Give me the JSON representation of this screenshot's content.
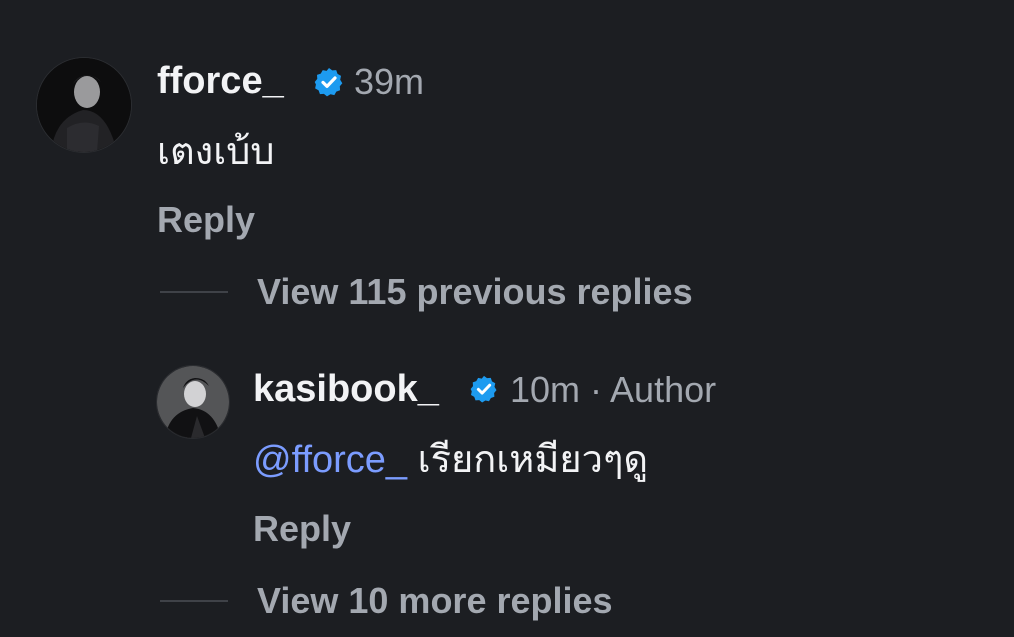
{
  "comments": [
    {
      "username": "fforce_",
      "time": "39m",
      "text": "เตงเบ้บ",
      "reply_label": "Reply",
      "verified": true
    }
  ],
  "previous_replies": {
    "label": "View 115 previous replies"
  },
  "reply": {
    "username": "kasibook_",
    "meta": "10m · Author",
    "mention": "@fforce_",
    "text": " เรียกเหมียวๆดู",
    "reply_label": "Reply",
    "verified": true
  },
  "more_replies": {
    "label": "View 10 more replies"
  },
  "colors": {
    "background": "#1c1e22",
    "username": "#f2f3f5",
    "secondary": "#a3a8b0",
    "mention": "#7b9cff",
    "verified": "#1d9bf0"
  },
  "icons": {
    "verified": "verified-badge-icon",
    "avatar_1": "avatar",
    "avatar_2": "avatar"
  }
}
